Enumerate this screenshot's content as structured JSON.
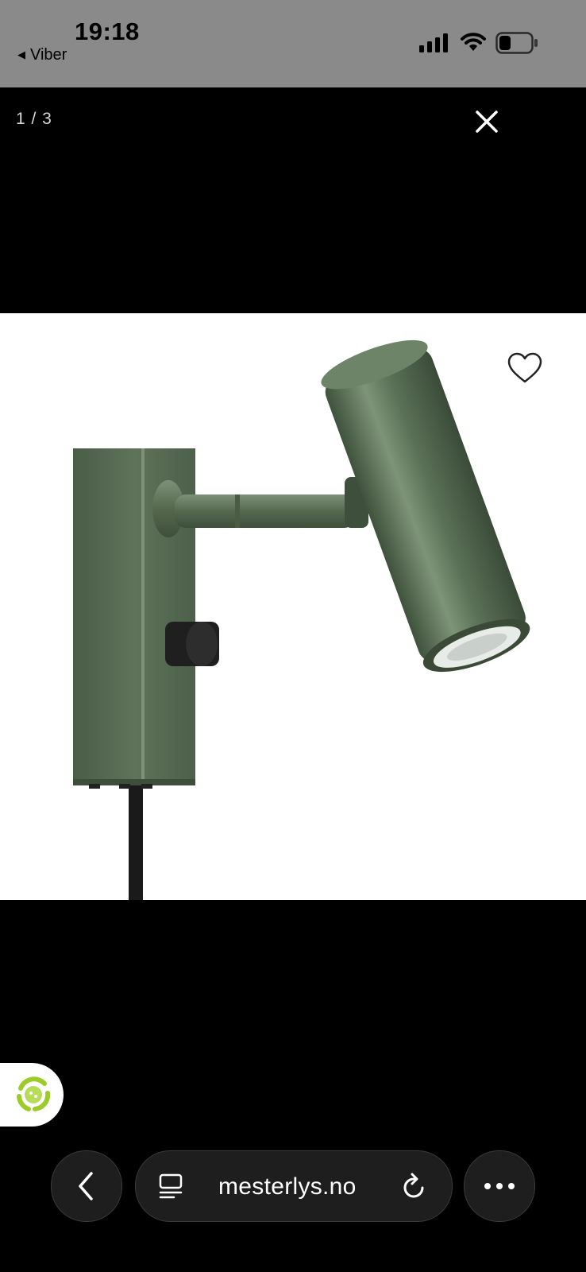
{
  "status_bar": {
    "time": "19:18",
    "back_app": "Viber",
    "background": "#8a8a8a"
  },
  "viewer": {
    "counter": "1 / 3",
    "close_icon": "close-icon",
    "favorite_icon": "heart-outline-icon",
    "product_image": "green-wall-spotlight-lamp"
  },
  "browser": {
    "url": "mesterlys.no",
    "back_icon": "chevron-left-icon",
    "tabs_icon": "reader-icon",
    "reload_icon": "reload-icon",
    "more_icon": "more-dots-icon",
    "badge_icon": "recycle-badge-icon",
    "accent": "#9ccc2a"
  }
}
